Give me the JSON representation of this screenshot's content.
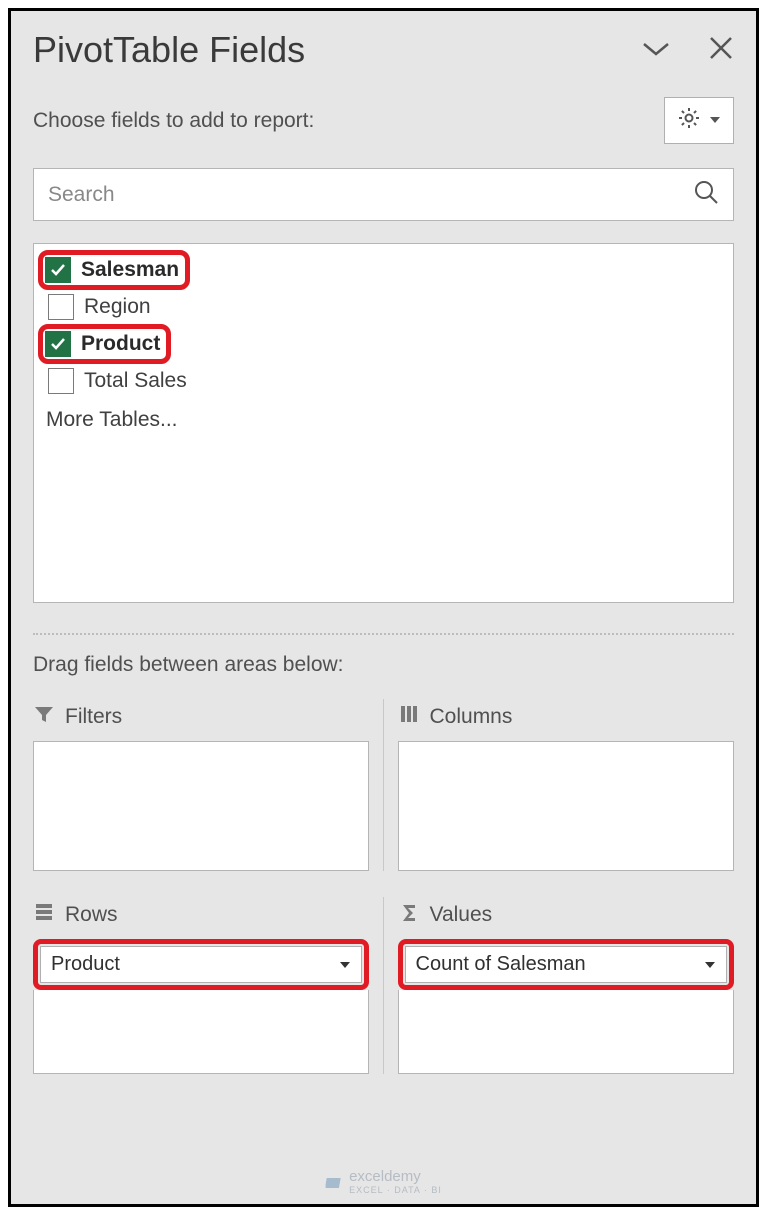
{
  "header": {
    "title": "PivotTable Fields"
  },
  "subtitle": "Choose fields to add to report:",
  "search": {
    "placeholder": "Search"
  },
  "fields": {
    "items": [
      {
        "label": "Salesman",
        "checked": true,
        "highlighted": true
      },
      {
        "label": "Region",
        "checked": false,
        "highlighted": false
      },
      {
        "label": "Product",
        "checked": true,
        "highlighted": true
      },
      {
        "label": "Total Sales",
        "checked": false,
        "highlighted": false
      }
    ],
    "more": "More Tables..."
  },
  "drag_label": "Drag fields between areas below:",
  "areas": {
    "filters": {
      "label": "Filters"
    },
    "columns": {
      "label": "Columns"
    },
    "rows": {
      "label": "Rows",
      "chip": "Product"
    },
    "values": {
      "label": "Values",
      "chip": "Count of Salesman"
    }
  },
  "watermark": {
    "name": "exceldemy",
    "sub": "EXCEL · DATA · BI"
  }
}
